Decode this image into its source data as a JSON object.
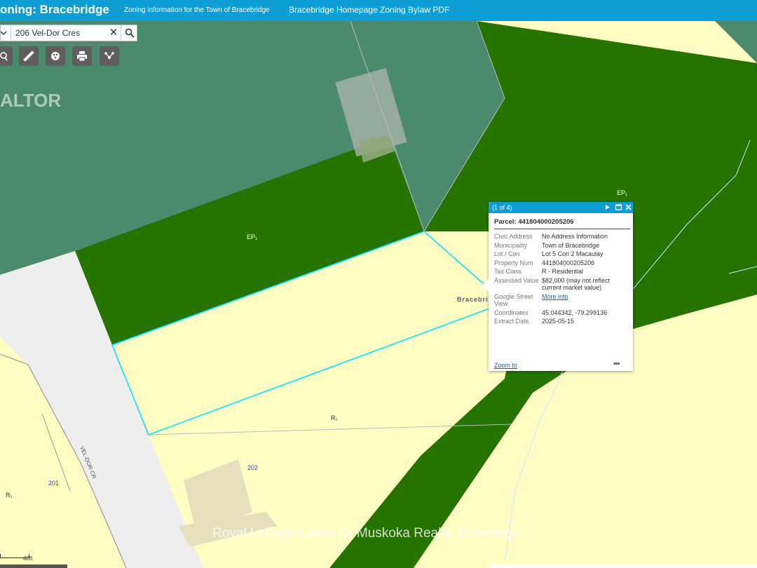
{
  "header": {
    "app_title": "oning: Bracebridge",
    "subtitle": "Zoning information for the Town of Bracebridge",
    "links": [
      "Bracebridge Homepage",
      "Zoning Bylaw PDF"
    ]
  },
  "search": {
    "value": "206 Vel-Dor Cres",
    "clear_icon": "close-icon",
    "search_icon": "search-icon"
  },
  "toolbar": {
    "tools": [
      "query-icon",
      "measure-icon",
      "layers-icon",
      "print-icon",
      "share-icon"
    ]
  },
  "map": {
    "labels": {
      "ep_center": "EP₁",
      "ep_right": "EP₁",
      "r1_center": "R₁",
      "r1_left": "R₁",
      "lot_202": "202",
      "lot_201": "201",
      "street": "VEL-DOR CR",
      "town": "Bracebrid"
    },
    "watermark": "Royal LePage Lakes Of Muskoka Realty, Brokerage",
    "realtor_mark": "ALTOR",
    "scale": "40ft",
    "colors": {
      "ep_zone": "#267300",
      "ep_overlay": "#4c8a6e",
      "residential_zone": "#fffdc4",
      "road": "#eeeeee",
      "selection": "#00e5ff",
      "header": "#0e9ed6"
    }
  },
  "popup": {
    "pager": "(1 of 4)",
    "title": "Parcel: 441804000205206",
    "rows": {
      "civic_address": {
        "key": "Civic Address",
        "value": "No Address Information"
      },
      "municipality": {
        "key": "Municipality",
        "value": "Town of Bracebridge"
      },
      "lot_con": {
        "key": "Lot / Con",
        "value": "Lot 5 Con 2 Macaulay"
      },
      "property_num": {
        "key": "Property Num",
        "value": "441804000205206"
      },
      "tax_class": {
        "key": "Tax Class",
        "value": "R - Residential"
      },
      "assessed_value": {
        "key": "Assessed Value",
        "value": "$82,000 (may not reflect current market value)"
      },
      "street_view": {
        "key": "Google Street View",
        "value": "More info"
      },
      "coordinates": {
        "key": "Coordinates",
        "value": "45.044342, -79.299136"
      },
      "extract_date": {
        "key": "Extract Date",
        "value": "2025-05-15"
      }
    },
    "zoom_link": "Zoom to",
    "more_menu": "•••"
  }
}
